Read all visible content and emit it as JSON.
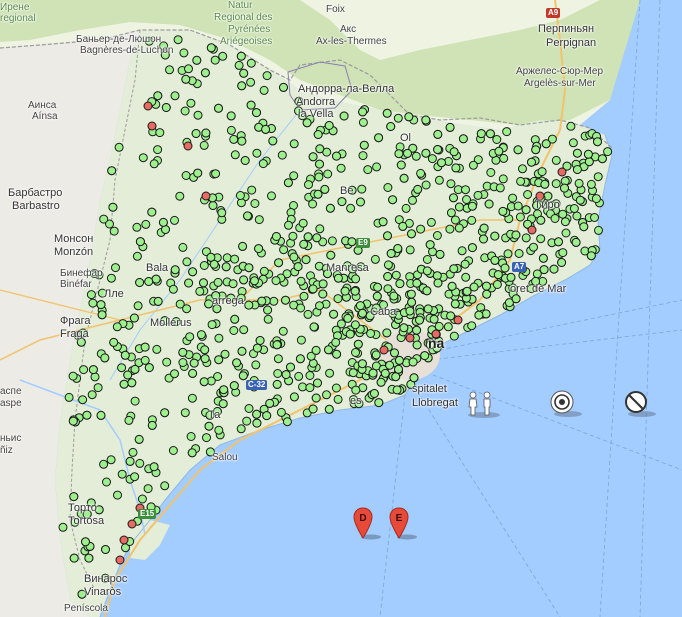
{
  "colors": {
    "sea": "#a3ccff",
    "land": "#f2efe9",
    "land_green": "#d5e8c2",
    "france": "#eef3e2",
    "spain_inland": "#ecebe6",
    "marker_green": "#9ef08f",
    "marker_red": "#e86a64",
    "marker_stroke": "#1a1a1a",
    "pin_red": "#e84a3a",
    "border": "#9b9b9b"
  },
  "labels": {
    "pyrenees_top": "Ирене",
    "regional_top": "regional",
    "natural_top1": "Natur",
    "natural_top2": "Regional des",
    "natural_top3": "Pyrénées",
    "natural_top4": "Ariégeoises",
    "foix": "Foix",
    "ax_ru": "Акс",
    "ax": "Ax-les-Thermes",
    "perpignan_ru": "Перпиньян",
    "perpignan": "Perpignan",
    "argeles_ru": "Аржелес-Сюр-Мер",
    "argeles": "Argelès-sur-Mer",
    "bagneres_ru": "Баньер-де-Люшон",
    "bagneres": "Bagnères-de-Luchon",
    "andorra_ru": "Андорра-ла-Велла",
    "andorra": "Andorra",
    "andorra2": "la Vella",
    "ainsa_ru": "Аинса",
    "ainsa": "Aínsa",
    "barbastro_ru": "Барбастро",
    "barbastro": "Barbastro",
    "monzon_ru": "Монсон",
    "monzon": "Monzón",
    "binefar_ru": "Бинефар",
    "binefar": "Binéfar",
    "fraga_ru": "Фрага",
    "fraga": "Fraga",
    "caspe_ru": "аспе",
    "caspe": "aspe",
    "alcaniz_ru": "ньис",
    "alcaniz": "ñiz",
    "tortosa_ru": "Торто",
    "tortosa": "Tortosa",
    "vinaros_ru": "Винарос",
    "vinaros": "Vinaròs",
    "peniscola": "Peníscola",
    "hospitalet1": "spitalet",
    "hospitalet2": "Llobregat",
    "lloret": "oret de Mar",
    "barcelona": "na",
    "salou": "Salou",
    "cabar": "Caba",
    "manresa": "Manresa",
    "tarrega": "arrega",
    "molle": "Mollerus",
    "balaguer": "Bala",
    "girona": "Гиро",
    "olot": "Ol",
    "berg": "Be",
    "lleida": "Лле",
    "tarr": "Та",
    "ges": "es"
  },
  "roads": [
    "A9",
    "E9",
    "A7",
    "E15",
    "C-32"
  ],
  "pins": [
    "D",
    "E"
  ],
  "controls": {
    "pegman": "pegman-icon",
    "target": "target-icon",
    "no": "no-entry-icon"
  }
}
